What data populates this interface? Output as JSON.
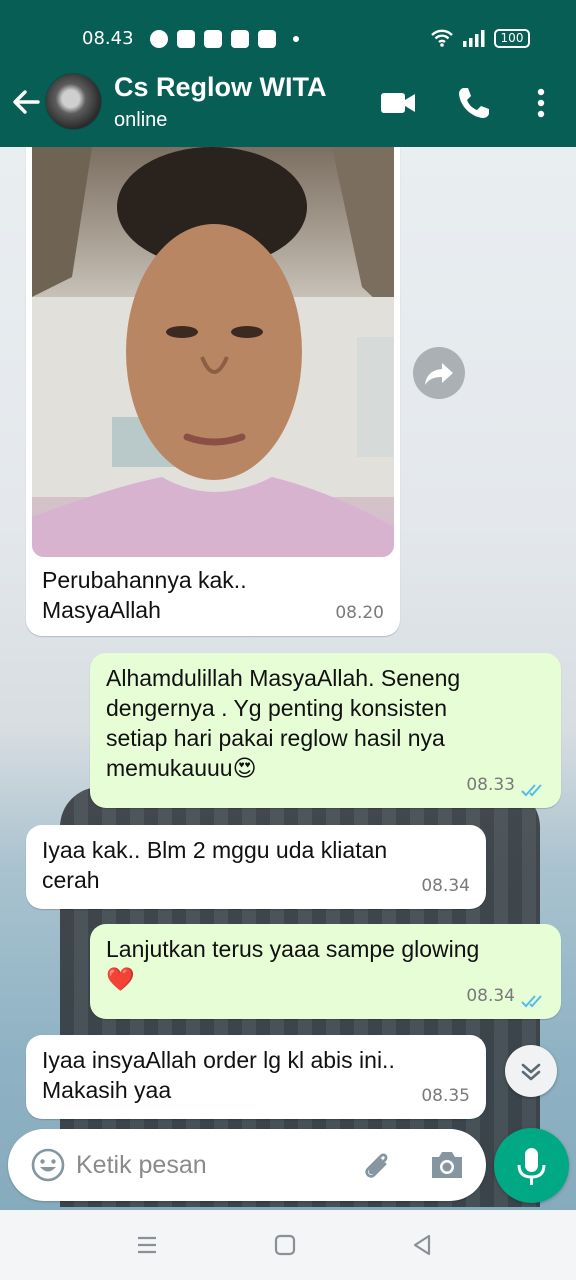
{
  "status_bar": {
    "time": "08.43",
    "battery": "100"
  },
  "header": {
    "contact_name": "Cs Reglow WITA",
    "contact_status": "online",
    "icons": [
      "back-arrow-icon",
      "video-call-icon",
      "phone-icon",
      "more-vert-icon"
    ]
  },
  "messages": [
    {
      "direction": "incoming",
      "type": "image",
      "caption_lines": [
        "Perubahannya kak..",
        "MasyaAllah"
      ],
      "time": "08.20"
    },
    {
      "direction": "outgoing",
      "lines": [
        "Alhamdulillah MasyaAllah. Seneng",
        "dengernya . Yg penting konsisten",
        "setiap hari pakai reglow hasil nya",
        "memukauuu😍"
      ],
      "time": "08.33",
      "read": true
    },
    {
      "direction": "incoming",
      "lines": [
        "Iyaa kak.. Blm 2 mggu uda kliatan",
        "cerah"
      ],
      "time": "08.34"
    },
    {
      "direction": "outgoing",
      "lines": [
        "Lanjutkan terus yaaa sampe glowing",
        "❤️"
      ],
      "time": "08.34",
      "read": true
    },
    {
      "direction": "incoming",
      "lines": [
        "Iyaa insyaAllah order lg kl abis ini..",
        "Makasih yaa"
      ],
      "time": "08.35"
    }
  ],
  "composer": {
    "placeholder": "Ketik pesan"
  },
  "colors": {
    "header": "#075e54",
    "outgoing_bubble": "#e7fdd6",
    "incoming_bubble": "#ffffff",
    "accent": "#00a884",
    "read_ticks": "#53bdeb"
  }
}
